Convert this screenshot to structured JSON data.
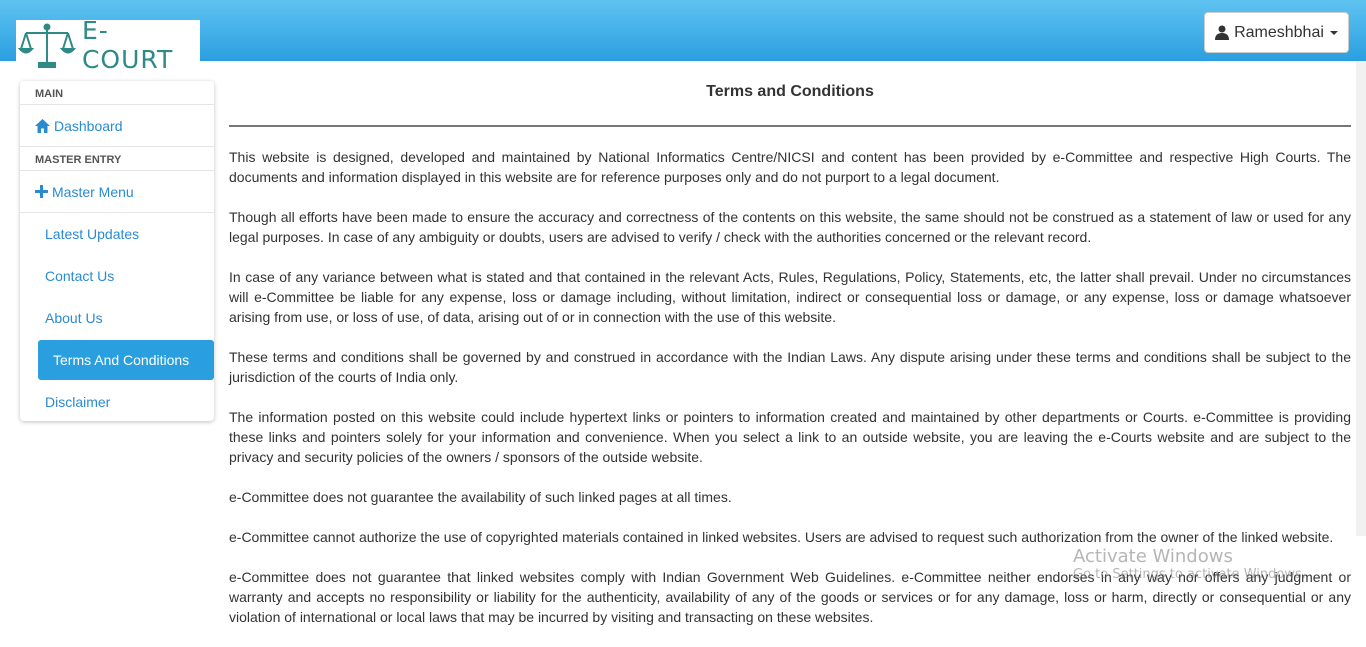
{
  "header": {
    "logo_text": "E-COURT",
    "user_name": "Rameshbhai"
  },
  "sidebar": {
    "section_main": "MAIN",
    "dashboard": "Dashboard",
    "section_master": "MASTER ENTRY",
    "master_menu": "Master Menu",
    "items": [
      {
        "label": "Latest Updates"
      },
      {
        "label": "Contact Us"
      },
      {
        "label": "About Us"
      },
      {
        "label": "Terms And Conditions"
      },
      {
        "label": "Disclaimer"
      }
    ]
  },
  "main": {
    "title": "Terms and Conditions",
    "paragraphs": [
      "This website is designed, developed and maintained by National Informatics Centre/NICSI and content has been provided by e-Committee and respective High Courts. The documents and information displayed in this website are for reference purposes only and do not purport to a legal document.",
      "Though all efforts have been made to ensure the accuracy and correctness of the contents on this website, the same should not be construed as a statement of law or used for any legal purposes. In case of any ambiguity or doubts, users are advised to verify / check with the authorities concerned or the relevant record.",
      "In case of any variance between what is stated and that contained in the relevant Acts, Rules, Regulations, Policy, Statements, etc, the latter shall prevail. Under no circumstances will e-Committee be liable for any expense, loss or damage including, without limitation, indirect or consequential loss or damage, or any expense, loss or damage whatsoever arising from use, or loss of use, of data, arising out of or in connection with the use of this website.",
      "These terms and conditions shall be governed by and construed in accordance with the Indian Laws. Any dispute arising under these terms and conditions shall be subject to the jurisdiction of the courts of India only.",
      "The information posted on this website could include hypertext links or pointers to information created and maintained by other departments or Courts. e-Committee is providing these links and pointers solely for your information and convenience. When you select a link to an outside website, you are leaving the e-Courts website and are subject to the privacy and security policies of the owners / sponsors of the outside website.",
      "e-Committee does not guarantee the availability of such linked pages at all times.",
      "e-Committee cannot authorize the use of copyrighted materials contained in linked websites. Users are advised to request such authorization from the owner of the linked website.",
      "e-Committee does not guarantee that linked websites comply with Indian Government Web Guidelines. e-Committee neither endorses in any way nor offers any judgment or warranty and accepts no responsibility or liability for the authenticity, availability of any of the goods or services or for any damage, loss or harm, directly or consequential or any violation of international or local laws that may be incurred by visiting and transacting on these websites."
    ]
  },
  "watermark": {
    "title": "Activate Windows",
    "subtitle": "Go to Settings to activate Windows."
  },
  "colors": {
    "header_top": "#5fc3f1",
    "header_bottom": "#2a9fe0",
    "link": "#2a8bd1",
    "active_bg": "#2a9fe0",
    "logo_teal": "#2e8a87"
  }
}
